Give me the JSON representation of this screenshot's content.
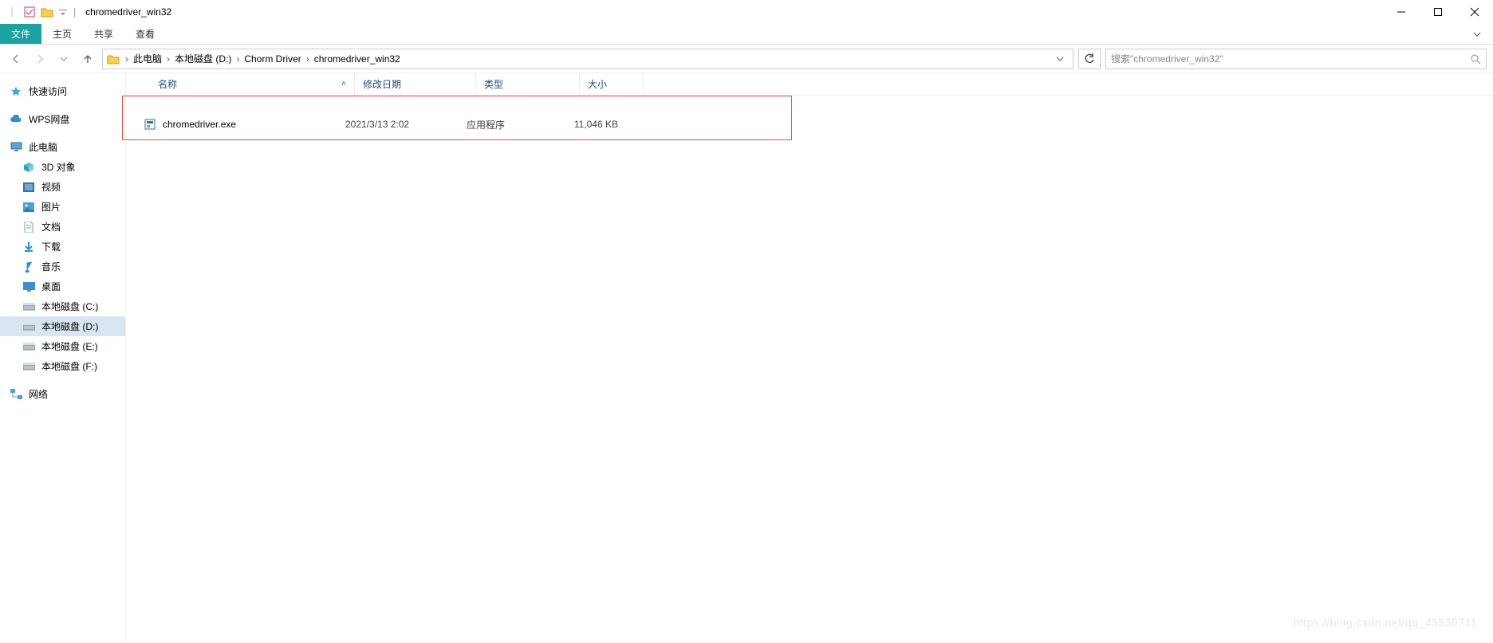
{
  "window": {
    "title": "chromedriver_win32"
  },
  "ribbon": {
    "file": "文件",
    "tabs": [
      "主页",
      "共享",
      "查看"
    ]
  },
  "breadcrumbs": [
    "此电脑",
    "本地磁盘 (D:)",
    "Chorm Driver",
    "chromedriver_win32"
  ],
  "search": {
    "placeholder": "搜索\"chromedriver_win32\""
  },
  "sidebar": {
    "quick_access": "快速访问",
    "wps": "WPS网盘",
    "this_pc": "此电脑",
    "this_pc_children": [
      "3D 对象",
      "视频",
      "图片",
      "文档",
      "下载",
      "音乐",
      "桌面",
      "本地磁盘 (C:)",
      "本地磁盘 (D:)",
      "本地磁盘 (E:)",
      "本地磁盘 (F:)"
    ],
    "network": "网络"
  },
  "columns": {
    "name": "名称",
    "date": "修改日期",
    "type": "类型",
    "size": "大小"
  },
  "files": [
    {
      "name": "chromedriver.exe",
      "date": "2021/3/13 2:02",
      "type": "应用程序",
      "size": "11,046 KB"
    }
  ],
  "watermark": "https://blog.csdn.net/qq_45530711"
}
